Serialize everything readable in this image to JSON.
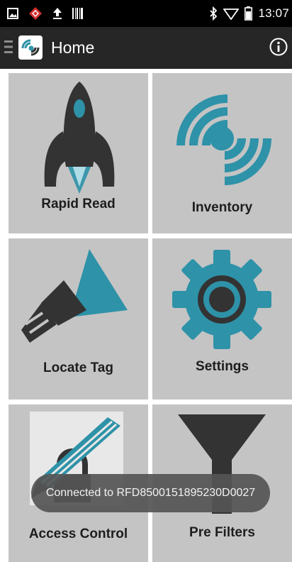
{
  "status_bar": {
    "time": "13:07",
    "icons": [
      "image-icon",
      "alert-diamond-icon",
      "upload-icon",
      "barcode-icon",
      "bluetooth-icon",
      "wifi-icon",
      "battery-icon"
    ]
  },
  "app_bar": {
    "title": "Home",
    "icons": [
      "menu-icon",
      "app-logo-icon",
      "info-icon"
    ]
  },
  "tiles": [
    {
      "label": "Rapid Read",
      "icon": "rocket-icon"
    },
    {
      "label": "Inventory",
      "icon": "signal-waves-icon"
    },
    {
      "label": "Locate Tag",
      "icon": "flashlight-icon"
    },
    {
      "label": "Settings",
      "icon": "gear-icon"
    },
    {
      "label": "Access Control",
      "icon": "lock-pencil-icon"
    },
    {
      "label": "Pre Filters",
      "icon": "funnel-icon"
    }
  ],
  "toast": {
    "message": "Connected to RFD8500151895230D0027"
  },
  "colors": {
    "accent_teal": "#2e92a8",
    "icon_dark": "#333333",
    "tile_bg": "#c4c4c4",
    "app_bar_bg": "#262626"
  }
}
